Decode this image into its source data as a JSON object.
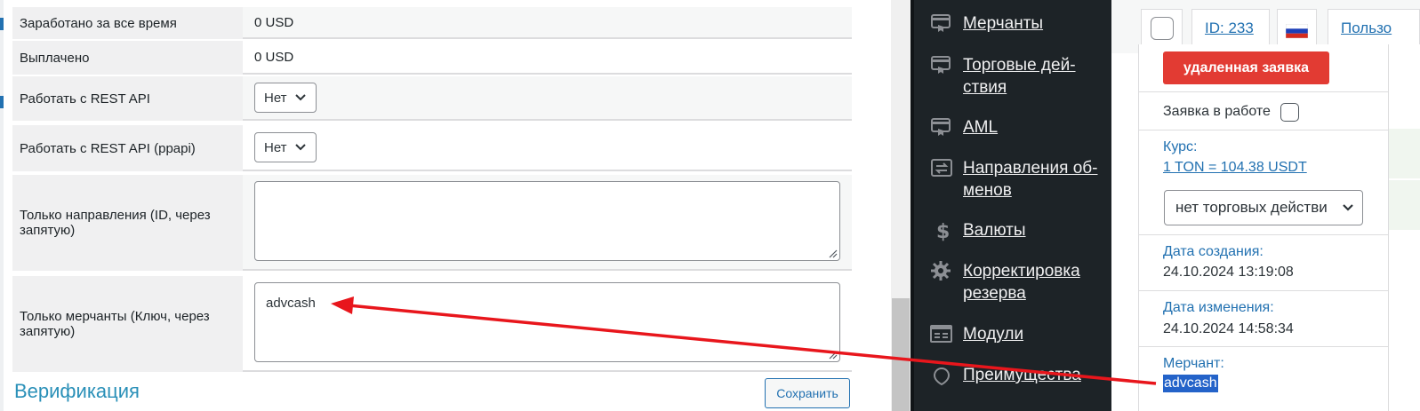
{
  "form": {
    "rows": [
      {
        "label": "Заработано за все время",
        "value": "0 USD"
      },
      {
        "label": "Выплачено",
        "value": "0 USD"
      },
      {
        "label": "Работать с REST API",
        "select": "Нет"
      },
      {
        "label": "Работать с REST API (ppapi)",
        "select": "Нет"
      },
      {
        "label": "Только направления (ID, через запятую)",
        "textarea": ""
      },
      {
        "label": "Только мерчанты (Ключ, через запятую)",
        "textarea": "advcash"
      }
    ],
    "section_title": "Верификация",
    "save_label": "Сохранить"
  },
  "sidebar": {
    "items": [
      {
        "label": "Мерчанты",
        "icon": "merchant-icon"
      },
      {
        "label": "Торговые дей-ствия",
        "icon": "trade-actions-icon"
      },
      {
        "label": "AML",
        "icon": "aml-icon"
      },
      {
        "label": "Направления об-менов",
        "icon": "exchange-directions-icon"
      },
      {
        "label": "Валюты",
        "icon": "dollar-icon"
      },
      {
        "label": "Корректировка резерва",
        "icon": "gear-icon"
      },
      {
        "label": "Модули",
        "icon": "modules-icon"
      },
      {
        "label": "Преимущества",
        "icon": "advantages-icon"
      }
    ]
  },
  "order": {
    "id_label": "ID: 233",
    "user_label": "Пользо",
    "status_badge": "удаленная заявка",
    "in_work_label": "Заявка в работе",
    "rate_label": "Курс:",
    "rate_value": "1 TON = 104.38 USDT",
    "trade_action_select": "нет торговых действи",
    "created_label": "Дата создания:",
    "created_value": "24.10.2024 13:19:08",
    "modified_label": "Дата изменения:",
    "modified_value": "24.10.2024 14:58:34",
    "merchant_label": "Мерчант:",
    "merchant_value": "advcash"
  },
  "colors": {
    "accent": "#2271b1",
    "badge_red": "#e23b33",
    "sidebar_bg": "#1d2327",
    "arrow_red": "#e8161c"
  }
}
